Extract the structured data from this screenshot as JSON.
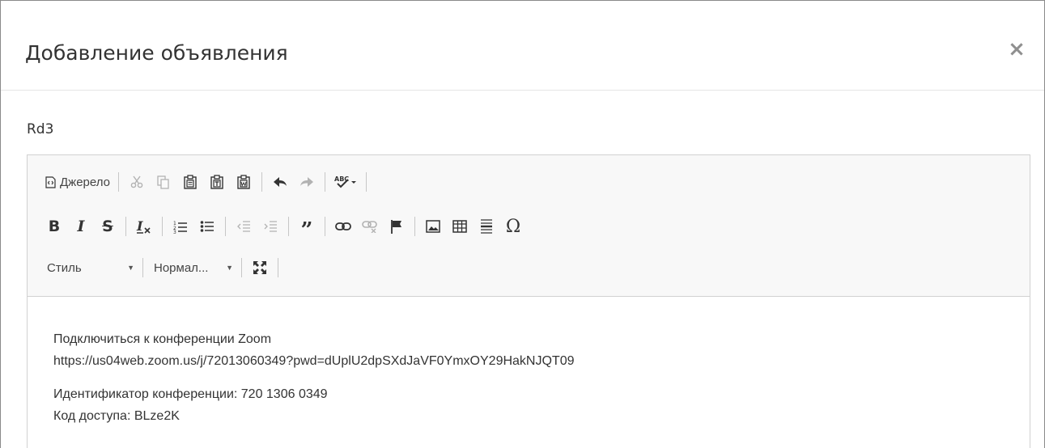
{
  "dialog": {
    "title": "Добавление объявления",
    "close_icon": "close-icon"
  },
  "form": {
    "title_value": "Rd3"
  },
  "editor": {
    "toolbar": {
      "source_label": "Джерело",
      "style_combo": "Стиль",
      "format_combo": "Нормал...",
      "icons": {
        "source": "source-icon",
        "cut": "cut-icon",
        "copy": "copy-icon",
        "paste": "paste-icon",
        "paste_text": "paste-text-icon",
        "paste_word": "paste-word-icon",
        "undo": "undo-icon",
        "redo": "redo-icon",
        "spellcheck": "spellcheck-icon",
        "bold": "B",
        "italic": "I",
        "strike": "S",
        "remove_format": "remove-format-icon",
        "numbered_list": "numbered-list-icon",
        "bulleted_list": "bulleted-list-icon",
        "outdent": "outdent-icon",
        "indent": "indent-icon",
        "blockquote": "blockquote-icon",
        "link": "link-icon",
        "unlink": "unlink-icon",
        "anchor": "anchor-flag-icon",
        "image": "image-icon",
        "table": "table-icon",
        "horizontal_rule": "horizontal-rule-icon",
        "special_char": "Ω",
        "maximize": "maximize-icon"
      }
    },
    "content": {
      "paragraphs": [
        {
          "line1": "Подключиться к конференции Zoom",
          "line2": "https://us04web.zoom.us/j/72013060349?pwd=dUplU2dpSXdJaVF0YmxOY29HakNJQT09"
        },
        {
          "line1": "Идентификатор конференции: 720 1306 0349",
          "line2": "Код доступа: BLze2K"
        }
      ]
    }
  }
}
